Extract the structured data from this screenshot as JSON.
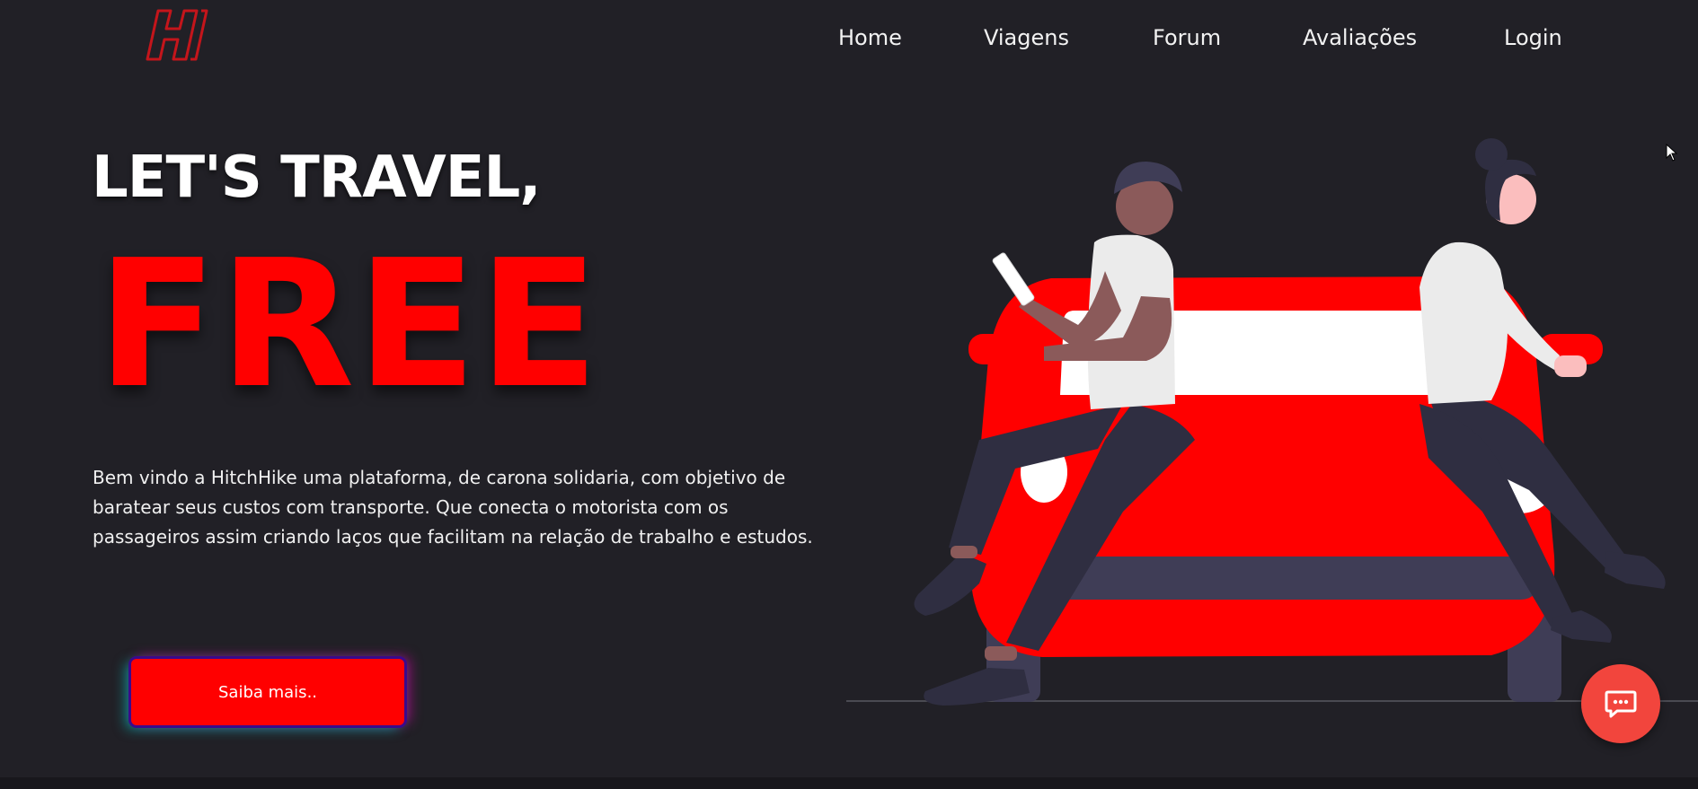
{
  "header": {
    "logo_letter": "H",
    "nav": [
      {
        "label": "Home"
      },
      {
        "label": "Viagens"
      },
      {
        "label": "Forum"
      },
      {
        "label": "Avaliações"
      },
      {
        "label": "Login"
      }
    ]
  },
  "hero": {
    "headline": "LET'S TRAVEL,",
    "highlight": "FREE",
    "description": "Bem vindo a HitchHike uma plataforma, de carona solidaria, com objetivo de baratear seus custos com transporte. Que conecta o motorista com os passageiros assim criando laços que facilitam na relação de trabalho e estudos.",
    "button_label": "Saiba mais.."
  },
  "colors": {
    "background": "#212026",
    "accent": "#ff0000",
    "chat_button": "#f2453d",
    "text": "#ffffff"
  },
  "icons": {
    "logo": "hitchhike-h-logo",
    "chat": "chat-bubble-icon",
    "cursor": "mouse-pointer"
  }
}
